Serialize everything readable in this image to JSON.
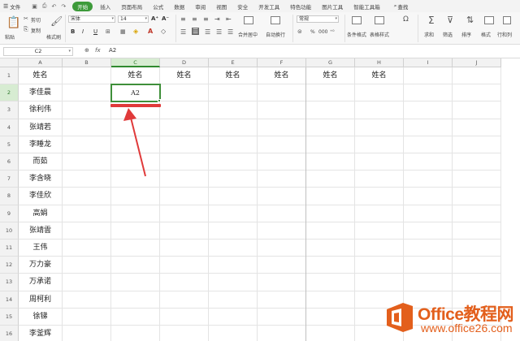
{
  "menu": {
    "file": "文件",
    "items": [
      "开始",
      "插入",
      "页面布局",
      "公式",
      "数据",
      "审阅",
      "视图",
      "安全",
      "开发工具",
      "特色功能",
      "图片工具",
      "智能工具箱"
    ],
    "active_index": 0,
    "search": "查找"
  },
  "ribbon": {
    "cut": "剪切",
    "copy": "复制",
    "paste": "粘贴",
    "format_painter": "格式刷",
    "font_name": "宋体",
    "font_size": "14",
    "bold": "B",
    "italic": "I",
    "underline": "U",
    "merge_center": "合并居中",
    "wrap_text": "自动换行",
    "number_format": "常规",
    "conditional_format": "条件格式",
    "table_style": "表格样式",
    "sum": "求和",
    "filter": "筛选",
    "sort": "排序",
    "format": "格式",
    "row_col": "行和列",
    "percent": "%",
    "thousands": "000"
  },
  "formula_bar": {
    "cell_ref": "C2",
    "fx": "fx",
    "value": "A2"
  },
  "columns": [
    "A",
    "B",
    "C",
    "D",
    "E",
    "F",
    "G",
    "H",
    "I",
    "J"
  ],
  "rows": [
    "1",
    "2",
    "3",
    "4",
    "5",
    "6",
    "7",
    "8",
    "9",
    "10",
    "11",
    "12",
    "13",
    "14",
    "15",
    "16"
  ],
  "cells": {
    "A1": "姓名",
    "C1": "姓名",
    "D1": "姓名",
    "E1": "姓名",
    "F1": "姓名",
    "G1": "姓名",
    "H1": "姓名",
    "C2": "A2",
    "A2": "李佳晨",
    "A3": "徐利伟",
    "A4": "张靖若",
    "A5": "李睡龙",
    "A6": "而茹",
    "A7": "李含晓",
    "A8": "李佳欣",
    "A9": "高娟",
    "A10": "张靖雲",
    "A11": "王伟",
    "A12": "万力豪",
    "A13": "万承诺",
    "A14": "周柯利",
    "A15": "徐锑",
    "A16": "李釜辉"
  },
  "selected_cell": "C2",
  "logo": {
    "main": "Office教程网",
    "sub": "www.office26.com"
  },
  "colors": {
    "accent_green": "#3d9a3a",
    "arrow_red": "#e03a3a",
    "logo_orange": "#e35f1c"
  }
}
